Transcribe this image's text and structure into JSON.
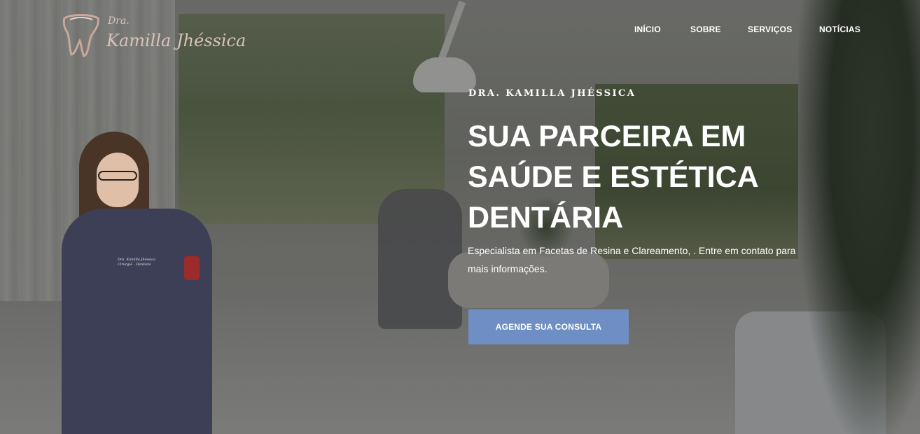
{
  "logo": {
    "prefix": "Dra.",
    "name": "Kamilla Jhéssica",
    "icon": "tooth-logo-icon"
  },
  "nav": {
    "items": [
      {
        "label": "INÍCIO"
      },
      {
        "label": "SOBRE"
      },
      {
        "label": "SERVIÇOS"
      },
      {
        "label": "NOTÍCIAS"
      }
    ]
  },
  "hero": {
    "eyebrow": "DRA. KAMILLA JHÉSSICA",
    "headline": [
      "SUA PARCEIRA EM",
      "SAÚDE E ESTÉTICA",
      "DENTÁRIA"
    ],
    "description": "Especialista em Facetas de Resina e Clareamento, . Entre em contato para mais informações.",
    "cta_label": "AGENDE SUA CONSULTA"
  },
  "doctor": {
    "coat_tag_line1": "Dra. Kamilla Jhéssica",
    "coat_tag_line2": "Cirurgiã - Dentista"
  },
  "colors": {
    "cta_background": "#6f8fc4",
    "logo_color": "#d8c3b8",
    "text": "#ffffff"
  }
}
